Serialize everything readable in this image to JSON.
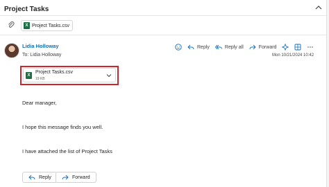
{
  "header": {
    "subject": "Project Tasks"
  },
  "attachment_bar": {
    "file_name": "Project Tasks.csv",
    "file_icon_label": "X"
  },
  "message": {
    "sender_name": "Lidia Holloway",
    "to_label": "To:",
    "to_name": "Lidia Holloway",
    "date": "Mon 10/21/2024 10:42",
    "attachment": {
      "file_name": "Project Tasks.csv",
      "file_size": "19 KB"
    },
    "body": {
      "greeting": "Dear manager,",
      "line1": "I hope this message finds you well.",
      "line2": "I have attached the list of Project Tasks"
    }
  },
  "toolbar": {
    "reply_label": "Reply",
    "reply_all_label": "Reply all",
    "forward_label": "Forward"
  },
  "bottom_actions": {
    "reply_label": "Reply",
    "forward_label": "Forward"
  },
  "colors": {
    "accent": "#0f6cbd",
    "highlight": "#d1232a",
    "excel": "#1d7044"
  }
}
